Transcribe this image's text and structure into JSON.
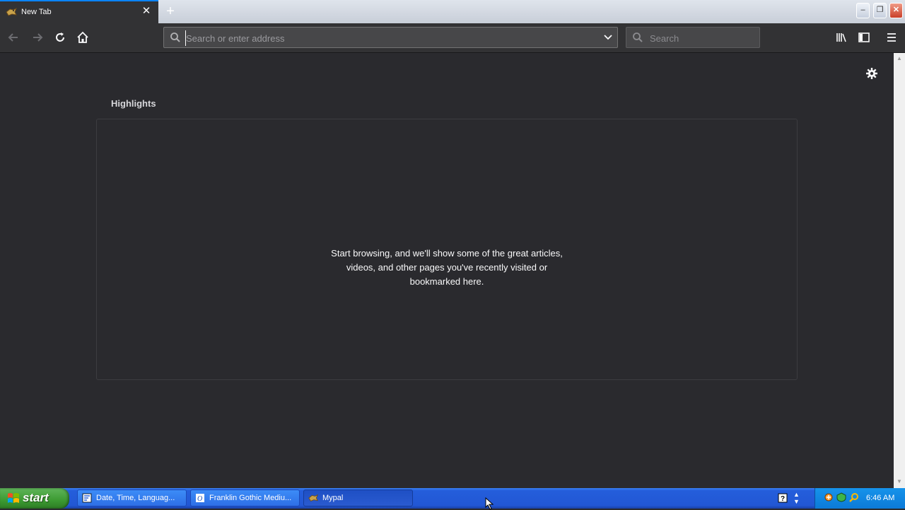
{
  "tab": {
    "title": "New Tab",
    "close_glyph": "✕",
    "favicon": "mypal-icon"
  },
  "new_tab_glyph": "+",
  "window_controls": {
    "minimize": "–",
    "maximize": "❐",
    "close": "✕"
  },
  "nav": {
    "back_icon": "back-arrow-icon",
    "forward_icon": "forward-arrow-icon",
    "reload_icon": "reload-icon",
    "home_icon": "home-icon",
    "url_placeholder": "Search or enter address",
    "url_value": "",
    "search_placeholder": "Search",
    "library_icon": "library-icon",
    "sidebar_icon": "sidebar-icon",
    "menu_icon": "hamburger-menu-icon"
  },
  "content": {
    "settings_icon": "gear-icon",
    "highlights_title": "Highlights",
    "empty_message": {
      "line1": "Start browsing, and we'll show some of the great articles,",
      "line2": "videos, and other pages you've recently visited or",
      "line3": "bookmarked here."
    }
  },
  "taskbar": {
    "start_label": "start",
    "items": [
      {
        "label": "Date, Time, Languag...",
        "icon": "control-panel-icon",
        "active": false
      },
      {
        "label": "Franklin Gothic Mediu...",
        "icon": "font-icon",
        "active": false
      },
      {
        "label": "Mypal",
        "icon": "mypal-icon",
        "active": true
      }
    ],
    "clock": "6:46 AM"
  },
  "colors": {
    "content_bg": "#2a2a2e",
    "toolbar_bg": "#323234",
    "tab_accent": "#0a84ff",
    "taskbar_blue": "#245edb",
    "start_green": "#3c9a32"
  }
}
